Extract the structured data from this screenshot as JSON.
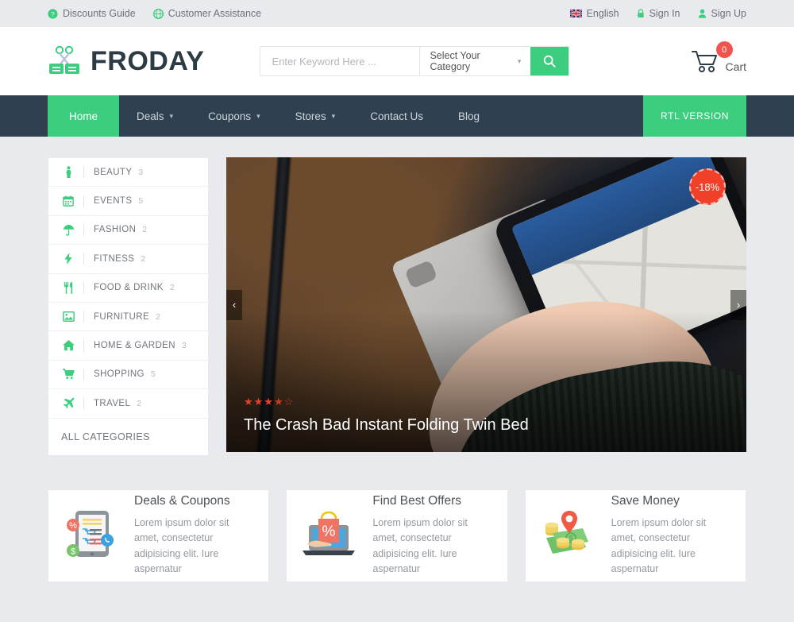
{
  "topbar": {
    "left": [
      {
        "label": "Discounts Guide",
        "icon": "question-circle-icon"
      },
      {
        "label": "Customer Assistance",
        "icon": "support-globe-icon"
      }
    ],
    "right": [
      {
        "label": "English",
        "icon": "uk-flag-icon"
      },
      {
        "label": "Sign In",
        "icon": "lock-icon"
      },
      {
        "label": "Sign Up",
        "icon": "user-icon"
      }
    ]
  },
  "header": {
    "logo_text": "FRODAY",
    "logo_icon": "scissors-coupon-icon",
    "search": {
      "placeholder": "Enter Keyword Here ...",
      "value": "",
      "category_label": "Select Your Category",
      "button_icon": "search-icon"
    },
    "cart": {
      "icon": "shopping-cart-icon",
      "count": "0",
      "label": "Cart"
    }
  },
  "nav": {
    "items": [
      {
        "label": "Home",
        "has_dropdown": false,
        "active": true
      },
      {
        "label": "Deals",
        "has_dropdown": true,
        "active": false
      },
      {
        "label": "Coupons",
        "has_dropdown": true,
        "active": false
      },
      {
        "label": "Stores",
        "has_dropdown": true,
        "active": false
      },
      {
        "label": "Contact Us",
        "has_dropdown": false,
        "active": false
      },
      {
        "label": "Blog",
        "has_dropdown": false,
        "active": false
      }
    ],
    "rtl_label": "RTL VERSION"
  },
  "categories": {
    "items": [
      {
        "label": "BEAUTY",
        "count": "3",
        "icon": "person-beauty-icon"
      },
      {
        "label": "EVENTS",
        "count": "5",
        "icon": "calendar-icon"
      },
      {
        "label": "FASHION",
        "count": "2",
        "icon": "umbrella-icon"
      },
      {
        "label": "FITNESS",
        "count": "2",
        "icon": "bolt-icon"
      },
      {
        "label": "FOOD & DRINK",
        "count": "2",
        "icon": "cutlery-icon"
      },
      {
        "label": "FURNITURE",
        "count": "2",
        "icon": "image-icon"
      },
      {
        "label": "HOME & GARDEN",
        "count": "3",
        "icon": "home-icon"
      },
      {
        "label": "SHOPPING",
        "count": "5",
        "icon": "cart-icon"
      },
      {
        "label": "TRAVEL",
        "count": "2",
        "icon": "plane-icon"
      }
    ],
    "all_label": "ALL CATEGORIES"
  },
  "hero": {
    "title": "The Crash Bad Instant Folding Twin Bed",
    "rating": "3.5",
    "stars_full": 3,
    "stars_half": 1,
    "stars_empty": 1,
    "discount": "-18%",
    "prev_icon": "chevron-left-icon",
    "next_icon": "chevron-right-icon"
  },
  "features": [
    {
      "title": "Deals & Coupons",
      "desc": "Lorem ipsum dolor sit amet, consectetur adipisicing elit. Iure aspernatur",
      "icon": "tablet-deals-icon"
    },
    {
      "title": "Find Best Offers",
      "desc": "Lorem ipsum dolor sit amet, consectetur adipisicing elit. Iure aspernatur",
      "icon": "laptop-shopping-bag-icon"
    },
    {
      "title": "Save Money",
      "desc": "Lorem ipsum dolor sit amet, consectetur adipisicing elit. Iure aspernatur",
      "icon": "money-pin-icon"
    }
  ],
  "colors": {
    "accent_green": "#3ccd7f",
    "nav_dark": "#2f4050",
    "badge_red": "#f0402a",
    "cart_red": "#f0544f",
    "page_bg": "#e9eaee"
  }
}
